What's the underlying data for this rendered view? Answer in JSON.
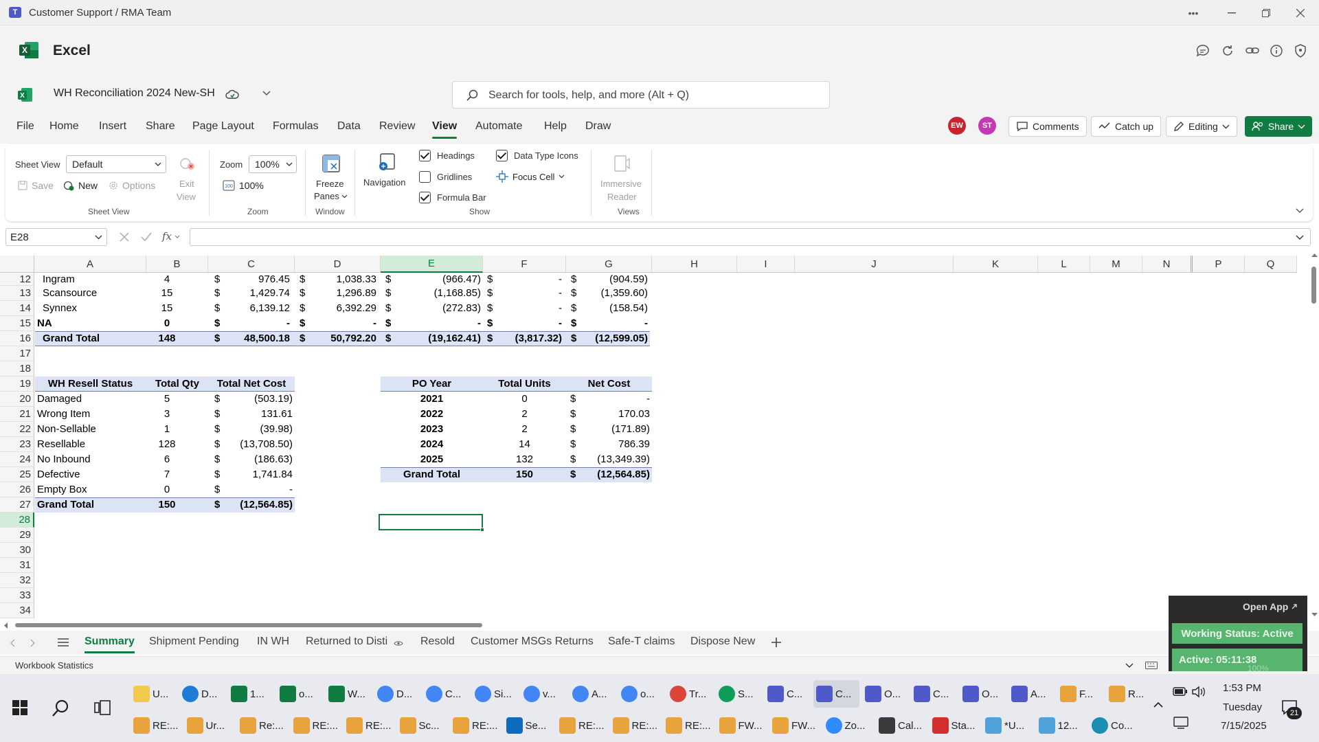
{
  "window": {
    "title": "Customer Support / RMA Team",
    "app_name": "Excel"
  },
  "doc": {
    "title": "WH Reconciliation 2024 New-SH",
    "search_placeholder": "Search for tools, help, and more (Alt + Q)"
  },
  "menu": [
    "File",
    "Home",
    "Insert",
    "Share",
    "Page Layout",
    "Formulas",
    "Data",
    "Review",
    "View",
    "Automate",
    "Help",
    "Draw"
  ],
  "menu_active": "View",
  "header": {
    "avatars": [
      "EW",
      "ST"
    ],
    "comments": "Comments",
    "catchup": "Catch up",
    "editing": "Editing",
    "share": "Share"
  },
  "ribbon": {
    "sheet_view_label": "Sheet View",
    "sheet_view_value": "Default",
    "save": "Save",
    "new": "New",
    "options": "Options",
    "exit": "Exit",
    "exit2": "View",
    "group_sheetview": "Sheet View",
    "zoom_label": "Zoom",
    "zoom_value": "100%",
    "zoom100": "100%",
    "group_zoom": "Zoom",
    "freeze": "Freeze",
    "panes": "Panes",
    "group_window": "Window",
    "navigation": "Navigation",
    "headings": "Headings",
    "gridlines": "Gridlines",
    "formula_bar": "Formula Bar",
    "data_type_icons": "Data Type Icons",
    "focus_cell": "Focus Cell",
    "group_show": "Show",
    "immersive": "Immersive",
    "reader": "Reader",
    "group_views": "Views"
  },
  "formula": {
    "namebox": "E28",
    "fx": "fx"
  },
  "columns": [
    "A",
    "B",
    "C",
    "D",
    "E",
    "F",
    "G",
    "H",
    "I",
    "J",
    "K",
    "L",
    "M",
    "N",
    "P",
    "Q"
  ],
  "rows": [
    "12",
    "13",
    "14",
    "15",
    "16",
    "17",
    "18",
    "19",
    "20",
    "21",
    "22",
    "23",
    "24",
    "25",
    "26",
    "27",
    "28",
    "29",
    "30",
    "31",
    "32",
    "33",
    "34"
  ],
  "table1": [
    {
      "a": "Ingram",
      "b": "4",
      "c": "976.45",
      "d": "1,038.33",
      "e": "(966.47)",
      "f": "-",
      "g": "(904.59)"
    },
    {
      "a": "Scansource",
      "b": "15",
      "c": "1,429.74",
      "d": "1,296.89",
      "e": "(1,168.85)",
      "f": "-",
      "g": "(1,359.60)"
    },
    {
      "a": "Synnex",
      "b": "15",
      "c": "6,139.12",
      "d": "6,392.29",
      "e": "(272.83)",
      "f": "-",
      "g": "(158.54)"
    },
    {
      "a": "NA",
      "b": "0",
      "c": "-",
      "d": "-",
      "e": "-",
      "f": "-",
      "g": "-"
    },
    {
      "a": "Grand Total",
      "b": "148",
      "c": "48,500.18",
      "d": "50,792.20",
      "e": "(19,162.41)",
      "f": "(3,817.32)",
      "g": "(12,599.05)"
    }
  ],
  "dollar": "$",
  "table2": {
    "headers": [
      "WH Resell Status",
      "Total Qty",
      "Total Net Cost"
    ],
    "rows": [
      {
        "a": "Damaged",
        "b": "5",
        "c": "(503.19)"
      },
      {
        "a": "Wrong Item",
        "b": "3",
        "c": "131.61"
      },
      {
        "a": "Non-Sellable",
        "b": "1",
        "c": "(39.98)"
      },
      {
        "a": "Resellable",
        "b": "128",
        "c": "(13,708.50)"
      },
      {
        "a": "No Inbound",
        "b": "6",
        "c": "(186.63)"
      },
      {
        "a": "Defective",
        "b": "7",
        "c": "1,741.84"
      },
      {
        "a": "Empty Box",
        "b": "0",
        "c": "-"
      },
      {
        "a": "Grand Total",
        "b": "150",
        "c": "(12,564.85)"
      }
    ]
  },
  "table3": {
    "headers": [
      "PO Year",
      "Total Units",
      "Net Cost"
    ],
    "rows": [
      {
        "y": "2021",
        "u": "0",
        "c": "-"
      },
      {
        "y": "2022",
        "u": "2",
        "c": "170.03"
      },
      {
        "y": "2023",
        "u": "2",
        "c": "(171.89)"
      },
      {
        "y": "2024",
        "u": "14",
        "c": "786.39"
      },
      {
        "y": "2025",
        "u": "132",
        "c": "(13,349.39)"
      },
      {
        "y": "Grand Total",
        "u": "150",
        "c": "(12,564.85)"
      }
    ]
  },
  "sheets": [
    "Summary",
    "Shipment Pending",
    "IN WH",
    "Returned to Disti",
    "Resold",
    "Customer MSGs Returns",
    "Safe-T claims",
    "Dispose New"
  ],
  "status": {
    "left": "Workbook Statistics"
  },
  "widget": {
    "open": "Open App",
    "working": "Working Status: Active",
    "active": "Active: 05:11:38",
    "zoom": "100%"
  },
  "taskbar": {
    "row1": [
      {
        "label": "U...",
        "icon": "folder-icon",
        "color": "#f2c94c"
      },
      {
        "label": "D...",
        "icon": "edge-icon",
        "color": "#1f7bd8"
      },
      {
        "label": "1...",
        "icon": "excel-icon",
        "color": "#107c41"
      },
      {
        "label": "o...",
        "icon": "excel-icon",
        "color": "#107c41"
      },
      {
        "label": "W...",
        "icon": "excel-icon",
        "color": "#107c41"
      },
      {
        "label": "D...",
        "icon": "chrome-icon",
        "color": "#4285f4"
      },
      {
        "label": "C...",
        "icon": "chrome-icon",
        "color": "#4285f4"
      },
      {
        "label": "Si...",
        "icon": "chrome-icon",
        "color": "#4285f4"
      },
      {
        "label": "v...",
        "icon": "chrome-icon",
        "color": "#4285f4"
      },
      {
        "label": "A...",
        "icon": "chrome-icon",
        "color": "#4285f4"
      },
      {
        "label": "o...",
        "icon": "chrome-icon",
        "color": "#4285f4"
      },
      {
        "label": "Tr...",
        "icon": "chrome-icon",
        "color": "#db4437"
      },
      {
        "label": "S...",
        "icon": "chrome-icon",
        "color": "#0f9d58"
      },
      {
        "label": "C...",
        "icon": "teams-icon",
        "color": "#5059c9"
      },
      {
        "label": "C...",
        "icon": "teams-icon",
        "color": "#5059c9"
      },
      {
        "label": "O...",
        "icon": "teams-icon",
        "color": "#5059c9"
      },
      {
        "label": "C...",
        "icon": "teams-icon",
        "color": "#5059c9"
      },
      {
        "label": "O...",
        "icon": "teams-icon",
        "color": "#5059c9"
      },
      {
        "label": "A...",
        "icon": "teams-icon",
        "color": "#5059c9"
      },
      {
        "label": "F...",
        "icon": "mail-icon",
        "color": "#e8a33d"
      },
      {
        "label": "R...",
        "icon": "mail-icon",
        "color": "#e8a33d"
      }
    ],
    "row2": [
      {
        "label": "RE:...",
        "icon": "mail-icon",
        "color": "#e8a33d"
      },
      {
        "label": "Ur...",
        "icon": "mail-icon",
        "color": "#e8a33d"
      },
      {
        "label": "Re:...",
        "icon": "mail-icon",
        "color": "#e8a33d"
      },
      {
        "label": "RE:...",
        "icon": "mail-icon",
        "color": "#e8a33d"
      },
      {
        "label": "RE:...",
        "icon": "mail-icon",
        "color": "#e8a33d"
      },
      {
        "label": "Sc...",
        "icon": "mail-icon",
        "color": "#e8a33d"
      },
      {
        "label": "RE:...",
        "icon": "mail-icon",
        "color": "#e8a33d"
      },
      {
        "label": "Se...",
        "icon": "outlook-icon",
        "color": "#0f6cbd"
      },
      {
        "label": "RE:...",
        "icon": "mail-icon",
        "color": "#e8a33d"
      },
      {
        "label": "RE:...",
        "icon": "mail-icon",
        "color": "#e8a33d"
      },
      {
        "label": "RE:...",
        "icon": "mail-icon",
        "color": "#e8a33d"
      },
      {
        "label": "FW...",
        "icon": "mail-icon",
        "color": "#e8a33d"
      },
      {
        "label": "FW...",
        "icon": "mail-icon",
        "color": "#e8a33d"
      },
      {
        "label": "Zo...",
        "icon": "zoom-icon",
        "color": "#2d8cff"
      },
      {
        "label": "Cal...",
        "icon": "calculator-icon",
        "color": "#3a3a3a"
      },
      {
        "label": "Sta...",
        "icon": "pdf-icon",
        "color": "#d32f2f"
      },
      {
        "label": "*U...",
        "icon": "notepad-icon",
        "color": "#4fa3d9"
      },
      {
        "label": "12...",
        "icon": "notepad-icon",
        "color": "#4fa3d9"
      },
      {
        "label": "Co...",
        "icon": "copilot-icon",
        "color": "#1b8fb0"
      }
    ],
    "time": "1:53 PM",
    "day": "Tuesday",
    "date": "7/15/2025",
    "notif": "21"
  },
  "colors": {
    "excel_green": "#107c41",
    "selected_col": "#d3ecd9",
    "band": "#dbe3f4"
  }
}
